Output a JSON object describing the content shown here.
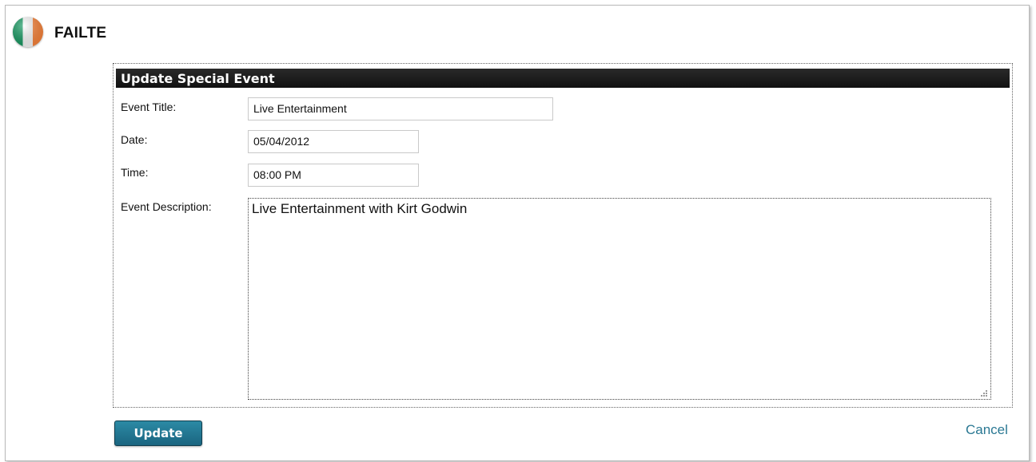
{
  "brand": {
    "name": "FAILTE",
    "icon": "ireland-flag-icon",
    "flag_colors": [
      "#169b62",
      "#ffffff",
      "#ff883e"
    ]
  },
  "form": {
    "header": "Update Special Event",
    "fields": {
      "event_title": {
        "label": "Event Title:",
        "value": "Live Entertainment"
      },
      "date": {
        "label": "Date:",
        "value": "05/04/2012"
      },
      "time": {
        "label": "Time:",
        "value": "08:00 PM"
      },
      "description": {
        "label": "Event Description:",
        "value": "Live Entertainment with Kirt Godwin"
      }
    },
    "update_label": "Update",
    "cancel_label": "Cancel"
  },
  "colors": {
    "header_bg": "#1a1a1a",
    "button_bg": "#1f7590",
    "link": "#2a7893"
  }
}
